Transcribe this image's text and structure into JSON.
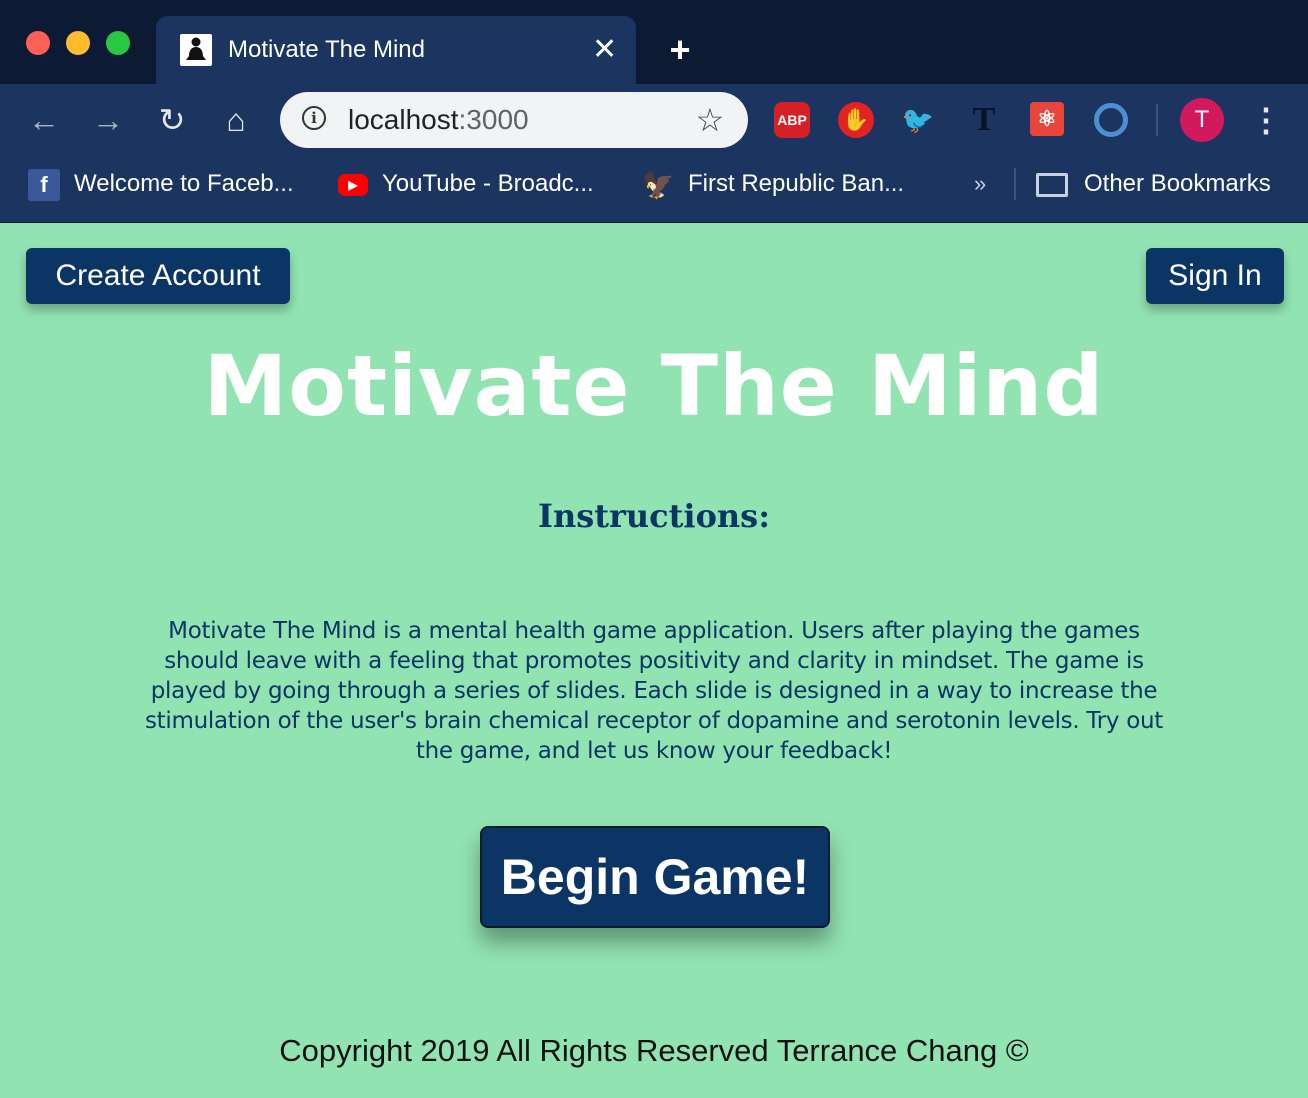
{
  "browser": {
    "tab": {
      "title": "Motivate The Mind",
      "favicon": "meditation-icon",
      "close_glyph": "✕"
    },
    "new_tab_glyph": "+",
    "nav": {
      "back": "←",
      "forward": "→",
      "reload": "↻",
      "home": "⌂"
    },
    "omnibox": {
      "host": "localhost",
      "port": ":3000",
      "star": "☆",
      "info": "i"
    },
    "extensions": [
      {
        "name": "adblock-plus-icon",
        "label": "ABP"
      },
      {
        "name": "stop-hand-icon",
        "label": "✋"
      },
      {
        "name": "bird-extension-icon",
        "label": "🐦"
      },
      {
        "name": "t-extension-icon",
        "label": "T"
      },
      {
        "name": "react-devtools-icon",
        "label": "⚛"
      },
      {
        "name": "ring-extension-icon",
        "label": ""
      }
    ],
    "avatar_letter": "T",
    "menu_glyph": "⋮",
    "bookmarks": [
      {
        "label": "Welcome to Faceb...",
        "icon": "f"
      },
      {
        "label": "YouTube - Broadc...",
        "icon": "▶"
      },
      {
        "label": "First Republic Ban...",
        "icon": "🦅"
      }
    ],
    "more_bookmarks": "»",
    "other_bookmarks": "Other Bookmarks"
  },
  "page": {
    "create_account": "Create Account",
    "sign_in": "Sign In",
    "title": "Motivate The Mind",
    "instructions_heading": "Instructions:",
    "description": "Motivate The Mind is a mental health game application. Users after playing the games should leave with a feeling that promotes positivity and clarity in mindset. The game is played by going through a series of slides. Each slide is designed in a way to increase the stimulation of the user's brain chemical receptor of dopamine and serotonin levels. Try out the game, and let us know your feedback!",
    "begin_button": "Begin Game!",
    "footer": "Copyright 2019 All Rights Reserved Terrance Chang ©"
  },
  "colors": {
    "page_background": "#92e3b2",
    "primary_navy": "#0b3565",
    "title_white": "#ffffff",
    "chrome_dark": "#0c1a33",
    "chrome_toolbar": "#1c3560"
  }
}
